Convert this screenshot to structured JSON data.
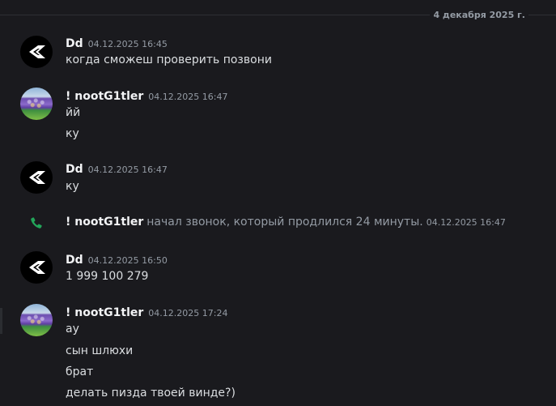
{
  "date_divider": "4 декабря 2025 г.",
  "messages": [
    {
      "username": "Dd",
      "timestamp": "04.12.2025 16:45",
      "lines": [
        "когда сможеш проверить позвони"
      ]
    },
    {
      "username": "! nootG1tler",
      "timestamp": "04.12.2025 16:47",
      "lines": [
        "йй",
        "ку"
      ]
    },
    {
      "username": "Dd",
      "timestamp": "04.12.2025 16:47",
      "lines": [
        "ку"
      ]
    },
    {
      "username": "Dd",
      "timestamp": "04.12.2025 16:50",
      "lines": [
        "1 999 100 279"
      ]
    },
    {
      "username": "! nootG1tler",
      "timestamp": "04.12.2025 17:24",
      "lines": [
        "ау",
        "сын шлюхи",
        "брат",
        "делать пизда твоей винде?)"
      ]
    }
  ],
  "call_event": {
    "username": "! nootG1tler",
    "text": "начал звонок, который продлился 24 минуты.",
    "timestamp": "04.12.2025 16:47"
  },
  "colors": {
    "background": "#1a1a1e",
    "call_icon": "#23a55a"
  },
  "icons": {
    "dd_avatar": "stylized-white-logo-on-black",
    "noot_avatar": "purple-crowd-photo",
    "call": "phone-icon"
  }
}
